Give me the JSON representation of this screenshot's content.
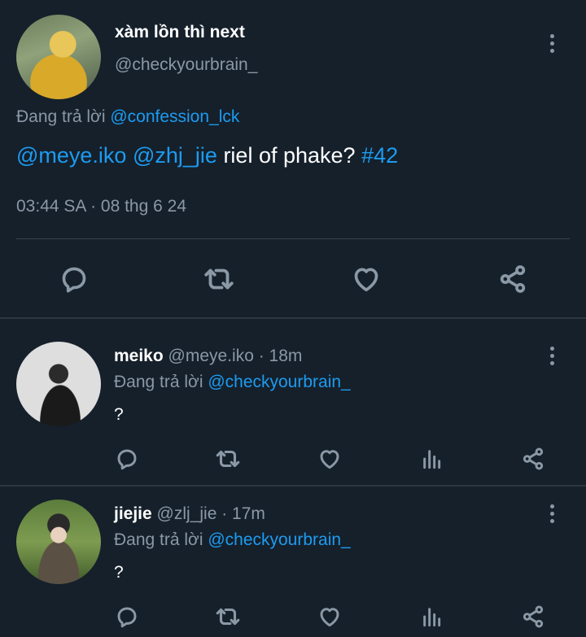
{
  "main_tweet": {
    "display_name": "xàm lồn thì next",
    "handle": "@checkyourbrain_",
    "reply_prefix": "Đang trả lời",
    "reply_to": "@confession_lck",
    "text_mention1": "@meye.iko",
    "text_mention2": "@zhj_jie",
    "text_body": "riel of phake?",
    "text_hashtag": "#42",
    "timestamp": "03:44 SA · 08 thg 6 24",
    "icons": [
      "reply-icon",
      "retweet-icon",
      "like-icon",
      "share-icon"
    ]
  },
  "replies": [
    {
      "display_name": "meiko",
      "meta": "@meye.iko · 18m",
      "reply_prefix": "Đang trả lời",
      "reply_to": "@checkyourbrain_",
      "text": "?",
      "icons": [
        "reply-icon",
        "retweet-icon",
        "like-icon",
        "analytics-icon",
        "share-icon"
      ]
    },
    {
      "display_name": "jiejie",
      "meta": "@zlj_jie · 17m",
      "reply_prefix": "Đang trả lời",
      "reply_to": "@checkyourbrain_",
      "text": "?",
      "icons": [
        "reply-icon",
        "retweet-icon",
        "like-icon",
        "analytics-icon",
        "share-icon"
      ]
    }
  ],
  "colors": {
    "background": "#15202b",
    "link": "#1d9bf0",
    "secondary_text": "#8b98a5",
    "divider": "#38444d"
  }
}
